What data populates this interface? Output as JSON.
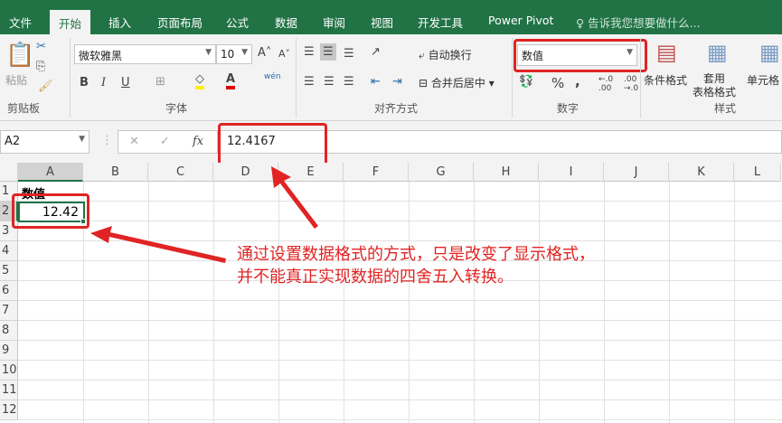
{
  "tabs": [
    "文件",
    "开始",
    "插入",
    "页面布局",
    "公式",
    "数据",
    "审阅",
    "视图",
    "开发工具",
    "Power Pivot"
  ],
  "tell_me": "告诉我您想要做什么...",
  "clipboard": {
    "paste": "粘贴",
    "group": "剪贴板"
  },
  "font": {
    "name": "微软雅黑",
    "size": "10",
    "bold": "B",
    "italic": "I",
    "underline": "U",
    "phonetic": "wén",
    "group": "字体"
  },
  "alignment": {
    "wrap": "自动换行",
    "merge": "合并后居中",
    "group": "对齐方式"
  },
  "number": {
    "format": "数值",
    "percent": "%",
    "comma": ",",
    "group": "数字"
  },
  "styles": {
    "conditional": "条件格式",
    "table": "套用\n表格格式",
    "cell": "单元格",
    "group": "样式"
  },
  "formula_bar": {
    "name_box": "A2",
    "fx": "fx",
    "value": "12.4167"
  },
  "columns": [
    "A",
    "B",
    "C",
    "D",
    "E",
    "F",
    "G",
    "H",
    "I",
    "J",
    "K",
    "L"
  ],
  "rows": [
    "1",
    "2",
    "3",
    "4",
    "5",
    "6",
    "7",
    "8",
    "9",
    "10",
    "11",
    "12"
  ],
  "cells": {
    "A1": "数值",
    "A2": "12.42"
  },
  "annotation": {
    "line1": "通过设置数据格式的方式，只是改变了显示格式，",
    "line2": "并不能真正实现数据的四舍五入转换。"
  }
}
